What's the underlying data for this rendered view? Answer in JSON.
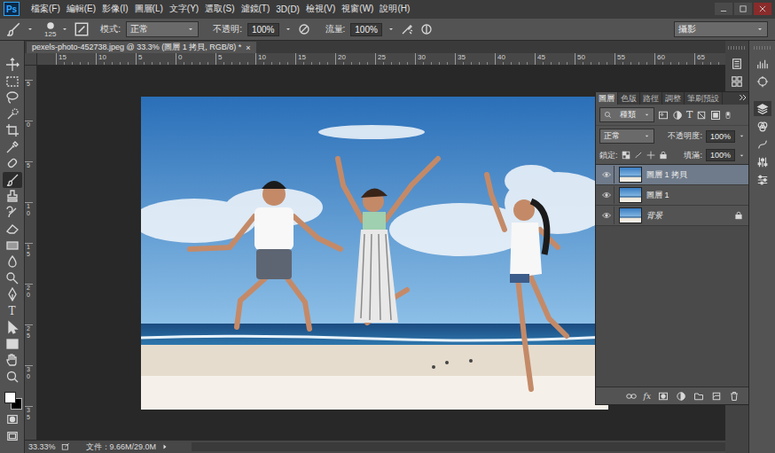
{
  "app": {
    "logo": "Ps"
  },
  "menu": [
    "檔案(F)",
    "編輯(E)",
    "影像(I)",
    "圖層(L)",
    "文字(Y)",
    "選取(S)",
    "濾鏡(T)",
    "3D(D)",
    "檢視(V)",
    "視窗(W)",
    "說明(H)"
  ],
  "options": {
    "brush_size": "125",
    "mode_label": "模式:",
    "mode": "正常",
    "opacity_label": "不透明:",
    "opacity": "100%",
    "flow_label": "流量:",
    "flow": "100%",
    "workspace": "攝影"
  },
  "document": {
    "tab": "pexels-photo-452738.jpeg @ 33.3% (圖層 1 拷貝, RGB/8) *",
    "close": "×"
  },
  "rulers": {
    "top": [
      "15",
      "10",
      "5",
      "0",
      "5",
      "10",
      "15",
      "20",
      "25",
      "30",
      "35",
      "40",
      "45",
      "50",
      "55",
      "60",
      "65"
    ],
    "left": [
      "5",
      "0",
      "5",
      "10",
      "15",
      "20",
      "25",
      "30",
      "35"
    ]
  },
  "tools": [
    {
      "selected": false
    },
    {
      "selected": false
    },
    {
      "selected": false
    },
    {
      "selected": false
    },
    {
      "selected": false
    },
    {
      "selected": false
    },
    {
      "selected": false
    },
    {
      "selected": true
    },
    {
      "selected": false
    },
    {
      "selected": false
    },
    {
      "selected": false
    },
    {
      "selected": false
    },
    {
      "selected": false
    },
    {
      "selected": false
    },
    {
      "selected": false
    },
    {
      "selected": false,
      "glyph": "T"
    },
    {
      "selected": false
    },
    {
      "selected": false
    },
    {
      "selected": false
    },
    {
      "selected": false
    }
  ],
  "layers_panel": {
    "tabs": [
      {
        "label": "圖層",
        "selected": true
      },
      {
        "label": "色版",
        "selected": false
      },
      {
        "label": "路徑",
        "selected": false
      },
      {
        "label": "調整",
        "selected": false
      },
      {
        "label": "筆刷預設",
        "selected": false
      }
    ],
    "filter": "種類",
    "filter_text_icon": "T",
    "blend": "正常",
    "opacity_label": "不透明度:",
    "opacity": "100%",
    "lock_label": "鎖定:",
    "fill_label": "填滿:",
    "fill": "100%",
    "layers": [
      {
        "name": "圖層 1 拷貝",
        "kind": "layer",
        "visible": true,
        "selected": true,
        "locked": false
      },
      {
        "name": "圖層 1",
        "kind": "layer",
        "visible": true,
        "selected": false,
        "locked": false
      },
      {
        "name": "背景",
        "kind": "background",
        "visible": true,
        "selected": false,
        "locked": true
      }
    ],
    "footer_fx": "fx"
  },
  "status_bar": {
    "zoom": "33.33%",
    "doc": "文件：9.66M/29.0M"
  }
}
